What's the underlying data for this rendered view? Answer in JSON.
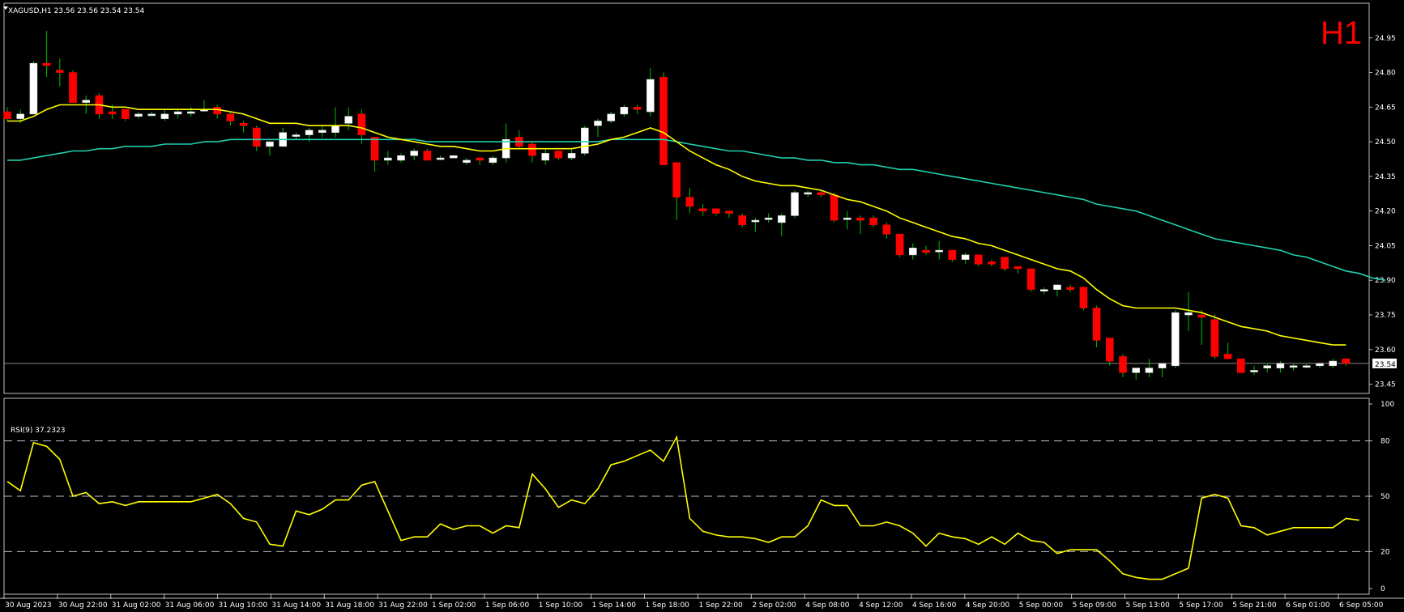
{
  "header": {
    "symbol_text": "XAGUSD,H1  23.56 23.56 23.54 23.54",
    "timeframe_badge": "H1",
    "current_price_label": "23.54"
  },
  "rsi_header": {
    "text": "RSI(9) 37.2323"
  },
  "colors": {
    "background": "#000000",
    "bull_candle": "#ffffff",
    "bear_candle": "#ff0000",
    "wick": "#00c000",
    "ma_fast": "#ffff00",
    "ma_slow": "#20d0b0",
    "rsi_line": "#ffff00",
    "grid_dash": "#c0c0c0",
    "frame": "#c0c0c0"
  },
  "chart_data": [
    {
      "type": "candlestick",
      "title": "XAGUSD,H1",
      "y_ticks": [
        "24.95",
        "24.80",
        "24.65",
        "24.50",
        "24.35",
        "24.20",
        "24.05",
        "23.90",
        "23.75",
        "23.60",
        "23.45"
      ],
      "ylim": [
        23.41,
        25.1
      ],
      "x_tick_labels": [
        "30 Aug 2023",
        "30 Aug 22:00",
        "31 Aug 02:00",
        "31 Aug 06:00",
        "31 Aug 10:00",
        "31 Aug 14:00",
        "31 Aug 18:00",
        "31 Aug 22:00",
        "1 Sep 02:00",
        "1 Sep 06:00",
        "1 Sep 10:00",
        "1 Sep 14:00",
        "1 Sep 18:00",
        "1 Sep 22:00",
        "2 Sep 02:00",
        "4 Sep 08:00",
        "4 Sep 12:00",
        "4 Sep 16:00",
        "4 Sep 20:00",
        "5 Sep 00:00",
        "5 Sep 09:00",
        "5 Sep 13:00",
        "5 Sep 17:00",
        "5 Sep 21:00",
        "6 Sep 01:00",
        "6 Sep 05:00"
      ],
      "candles": [
        [
          24.63,
          24.6,
          24.65,
          24.59
        ],
        [
          24.6,
          24.62,
          24.64,
          24.58
        ],
        [
          24.62,
          24.84,
          24.85,
          24.62
        ],
        [
          24.84,
          24.83,
          24.98,
          24.78
        ],
        [
          24.81,
          24.8,
          24.86,
          24.74
        ],
        [
          24.8,
          24.67,
          24.81,
          24.67
        ],
        [
          24.67,
          24.68,
          24.7,
          24.62
        ],
        [
          24.7,
          24.62,
          24.71,
          24.6
        ],
        [
          24.63,
          24.62,
          24.66,
          24.6
        ],
        [
          24.64,
          24.6,
          24.64,
          24.59
        ],
        [
          24.61,
          24.62,
          24.63,
          24.6
        ],
        [
          24.62,
          24.62,
          24.63,
          24.61
        ],
        [
          24.6,
          24.62,
          24.64,
          24.59
        ],
        [
          24.62,
          24.63,
          24.64,
          24.6
        ],
        [
          24.63,
          24.63,
          24.65,
          24.61
        ],
        [
          24.64,
          24.64,
          24.68,
          24.63
        ],
        [
          24.65,
          24.62,
          24.66,
          24.6
        ],
        [
          24.62,
          24.59,
          24.63,
          24.57
        ],
        [
          24.58,
          24.57,
          24.59,
          24.54
        ],
        [
          24.56,
          24.48,
          24.57,
          24.46
        ],
        [
          24.48,
          24.5,
          24.5,
          24.44
        ],
        [
          24.48,
          24.54,
          24.56,
          24.48
        ],
        [
          24.53,
          24.53,
          24.54,
          24.51
        ],
        [
          24.53,
          24.55,
          24.56,
          24.5
        ],
        [
          24.54,
          24.55,
          24.57,
          24.52
        ],
        [
          24.54,
          24.57,
          24.65,
          24.52
        ],
        [
          24.58,
          24.61,
          24.65,
          24.55
        ],
        [
          24.62,
          24.53,
          24.64,
          24.49
        ],
        [
          24.52,
          24.42,
          24.52,
          24.37
        ],
        [
          24.42,
          24.43,
          24.46,
          24.4
        ],
        [
          24.42,
          24.44,
          24.45,
          24.41
        ],
        [
          24.44,
          24.46,
          24.47,
          24.42
        ],
        [
          24.46,
          24.42,
          24.47,
          24.42
        ],
        [
          24.43,
          24.43,
          24.44,
          24.42
        ],
        [
          24.43,
          24.44,
          24.44,
          24.43
        ],
        [
          24.41,
          24.42,
          24.43,
          24.4
        ],
        [
          24.43,
          24.42,
          24.43,
          24.4
        ],
        [
          24.41,
          24.43,
          24.44,
          24.4
        ],
        [
          24.43,
          24.51,
          24.58,
          24.41
        ],
        [
          24.52,
          24.48,
          24.55,
          24.47
        ],
        [
          24.49,
          24.44,
          24.5,
          24.41
        ],
        [
          24.42,
          24.45,
          24.47,
          24.4
        ],
        [
          24.46,
          24.43,
          24.46,
          24.42
        ],
        [
          24.43,
          24.45,
          24.47,
          24.42
        ],
        [
          24.45,
          24.56,
          24.57,
          24.44
        ],
        [
          24.57,
          24.59,
          24.6,
          24.52
        ],
        [
          24.59,
          24.62,
          24.63,
          24.58
        ],
        [
          24.62,
          24.65,
          24.66,
          24.61
        ],
        [
          24.65,
          24.64,
          24.66,
          24.62
        ],
        [
          24.63,
          24.77,
          24.82,
          24.61
        ],
        [
          24.78,
          24.4,
          24.8,
          24.4
        ],
        [
          24.41,
          24.26,
          24.41,
          24.16
        ],
        [
          24.26,
          24.22,
          24.3,
          24.19
        ],
        [
          24.21,
          24.2,
          24.23,
          24.18
        ],
        [
          24.21,
          24.19,
          24.21,
          24.18
        ],
        [
          24.2,
          24.19,
          24.2,
          24.17
        ],
        [
          24.18,
          24.14,
          24.19,
          24.13
        ],
        [
          24.16,
          24.16,
          24.17,
          24.11
        ],
        [
          24.17,
          24.17,
          24.19,
          24.15
        ],
        [
          24.15,
          24.18,
          24.19,
          24.09
        ],
        [
          24.18,
          24.28,
          24.29,
          24.17
        ],
        [
          24.28,
          24.28,
          24.29,
          24.26
        ],
        [
          24.28,
          24.27,
          24.29,
          24.26
        ],
        [
          24.27,
          24.16,
          24.28,
          24.15
        ],
        [
          24.17,
          24.17,
          24.2,
          24.12
        ],
        [
          24.17,
          24.16,
          24.18,
          24.1
        ],
        [
          24.17,
          24.14,
          24.18,
          24.13
        ],
        [
          24.14,
          24.1,
          24.15,
          24.08
        ],
        [
          24.1,
          24.01,
          24.1,
          24.0
        ],
        [
          24.01,
          24.04,
          24.06,
          23.99
        ],
        [
          24.03,
          24.02,
          24.05,
          24.01
        ],
        [
          24.03,
          24.03,
          24.07,
          23.99
        ],
        [
          24.03,
          23.99,
          24.03,
          23.98
        ],
        [
          23.99,
          24.01,
          24.02,
          23.97
        ],
        [
          24.01,
          23.97,
          24.01,
          23.96
        ],
        [
          23.98,
          23.97,
          23.99,
          23.96
        ],
        [
          24.0,
          23.95,
          24.0,
          23.94
        ],
        [
          23.96,
          23.95,
          23.96,
          23.93
        ],
        [
          23.95,
          23.86,
          23.95,
          23.85
        ],
        [
          23.86,
          23.86,
          23.87,
          23.84
        ],
        [
          23.86,
          23.88,
          23.88,
          23.83
        ],
        [
          23.87,
          23.86,
          23.88,
          23.85
        ],
        [
          23.87,
          23.78,
          23.87,
          23.77
        ],
        [
          23.78,
          23.64,
          23.79,
          23.61
        ],
        [
          23.65,
          23.55,
          23.65,
          23.53
        ],
        [
          23.57,
          23.5,
          23.58,
          23.48
        ],
        [
          23.5,
          23.52,
          23.52,
          23.47
        ],
        [
          23.5,
          23.52,
          23.56,
          23.48
        ],
        [
          23.52,
          23.54,
          23.54,
          23.48
        ],
        [
          23.53,
          23.76,
          23.77,
          23.52
        ],
        [
          23.75,
          23.76,
          23.85,
          23.68
        ],
        [
          23.75,
          23.74,
          23.77,
          23.62
        ],
        [
          23.73,
          23.57,
          23.75,
          23.56
        ],
        [
          23.58,
          23.56,
          23.63,
          23.56
        ],
        [
          23.56,
          23.5,
          23.56,
          23.5
        ],
        [
          23.51,
          23.51,
          23.53,
          23.49
        ],
        [
          23.52,
          23.53,
          23.54,
          23.5
        ],
        [
          23.52,
          23.54,
          23.55,
          23.5
        ],
        [
          23.53,
          23.53,
          23.54,
          23.51
        ],
        [
          23.53,
          23.53,
          23.54,
          23.52
        ],
        [
          23.53,
          23.54,
          23.54,
          23.52
        ],
        [
          23.53,
          23.55,
          23.56,
          23.52
        ],
        [
          23.56,
          23.54,
          23.56,
          23.53
        ]
      ],
      "ma_fast": [
        24.59,
        24.59,
        24.61,
        24.64,
        24.66,
        24.66,
        24.66,
        24.66,
        24.65,
        24.65,
        24.64,
        24.64,
        24.64,
        24.64,
        24.64,
        24.64,
        24.64,
        24.63,
        24.62,
        24.6,
        24.58,
        24.58,
        24.58,
        24.57,
        24.57,
        24.57,
        24.57,
        24.56,
        24.54,
        24.52,
        24.51,
        24.5,
        24.49,
        24.48,
        24.48,
        24.47,
        24.46,
        24.46,
        24.47,
        24.47,
        24.47,
        24.47,
        24.47,
        24.47,
        24.48,
        24.49,
        24.51,
        24.52,
        24.54,
        24.56,
        24.54,
        24.5,
        24.46,
        24.43,
        24.4,
        24.38,
        24.35,
        24.33,
        24.32,
        24.31,
        24.31,
        24.3,
        24.29,
        24.27,
        24.25,
        24.24,
        24.22,
        24.2,
        24.17,
        24.15,
        24.13,
        24.11,
        24.09,
        24.08,
        24.06,
        24.05,
        24.03,
        24.01,
        23.99,
        23.97,
        23.95,
        23.94,
        23.91,
        23.86,
        23.82,
        23.79,
        23.78,
        23.78,
        23.78,
        23.78,
        23.77,
        23.76,
        23.74,
        23.72,
        23.7,
        23.69,
        23.68,
        23.66,
        23.65,
        23.64,
        23.63,
        23.62,
        23.62
      ],
      "ma_slow": [
        24.42,
        24.42,
        24.43,
        24.44,
        24.45,
        24.46,
        24.46,
        24.47,
        24.47,
        24.48,
        24.48,
        24.48,
        24.49,
        24.49,
        24.49,
        24.5,
        24.5,
        24.51,
        24.51,
        24.51,
        24.51,
        24.51,
        24.51,
        24.51,
        24.51,
        24.51,
        24.51,
        24.51,
        24.51,
        24.51,
        24.51,
        24.51,
        24.5,
        24.5,
        24.5,
        24.5,
        24.5,
        24.5,
        24.5,
        24.5,
        24.5,
        24.5,
        24.5,
        24.5,
        24.5,
        24.5,
        24.51,
        24.51,
        24.51,
        24.51,
        24.51,
        24.5,
        24.49,
        24.48,
        24.47,
        24.46,
        24.46,
        24.45,
        24.44,
        24.43,
        24.43,
        24.42,
        24.42,
        24.41,
        24.41,
        24.4,
        24.4,
        24.39,
        24.38,
        24.38,
        24.37,
        24.36,
        24.35,
        24.34,
        24.33,
        24.32,
        24.31,
        24.3,
        24.29,
        24.28,
        24.27,
        24.26,
        24.25,
        24.23,
        24.22,
        24.21,
        24.2,
        24.18,
        24.16,
        24.14,
        24.12,
        24.1,
        24.08,
        24.07,
        24.06,
        24.05,
        24.04,
        24.03,
        24.01,
        24.0,
        23.98,
        23.96,
        23.94,
        23.93,
        23.91,
        23.9
      ]
    },
    {
      "type": "line",
      "title": "RSI(9) 37.2323",
      "ylim": [
        0,
        100
      ],
      "y_ticks": [
        "100",
        "80",
        "50",
        "20",
        "0"
      ],
      "levels": [
        80,
        50,
        20
      ],
      "values": [
        58,
        53,
        79,
        77,
        70,
        50,
        52,
        46,
        47,
        45,
        47,
        47,
        47,
        47,
        47,
        49,
        51,
        46,
        38,
        36,
        24,
        23,
        42,
        40,
        43,
        48,
        48,
        56,
        58,
        42,
        26,
        28,
        28,
        35,
        32,
        34,
        34,
        30,
        34,
        33,
        62,
        54,
        44,
        48,
        46,
        54,
        67,
        69,
        72,
        75,
        69,
        82,
        38,
        31,
        29,
        28,
        28,
        27,
        25,
        28,
        28,
        34,
        48,
        45,
        45,
        34,
        34,
        36,
        34,
        30,
        23,
        30,
        28,
        27,
        24,
        28,
        24,
        30,
        26,
        25,
        19,
        21,
        21,
        21,
        15,
        8,
        6,
        5,
        5,
        8,
        11,
        49,
        51,
        49,
        34,
        33,
        29,
        31,
        33,
        33,
        33,
        33,
        38,
        37
      ]
    }
  ]
}
